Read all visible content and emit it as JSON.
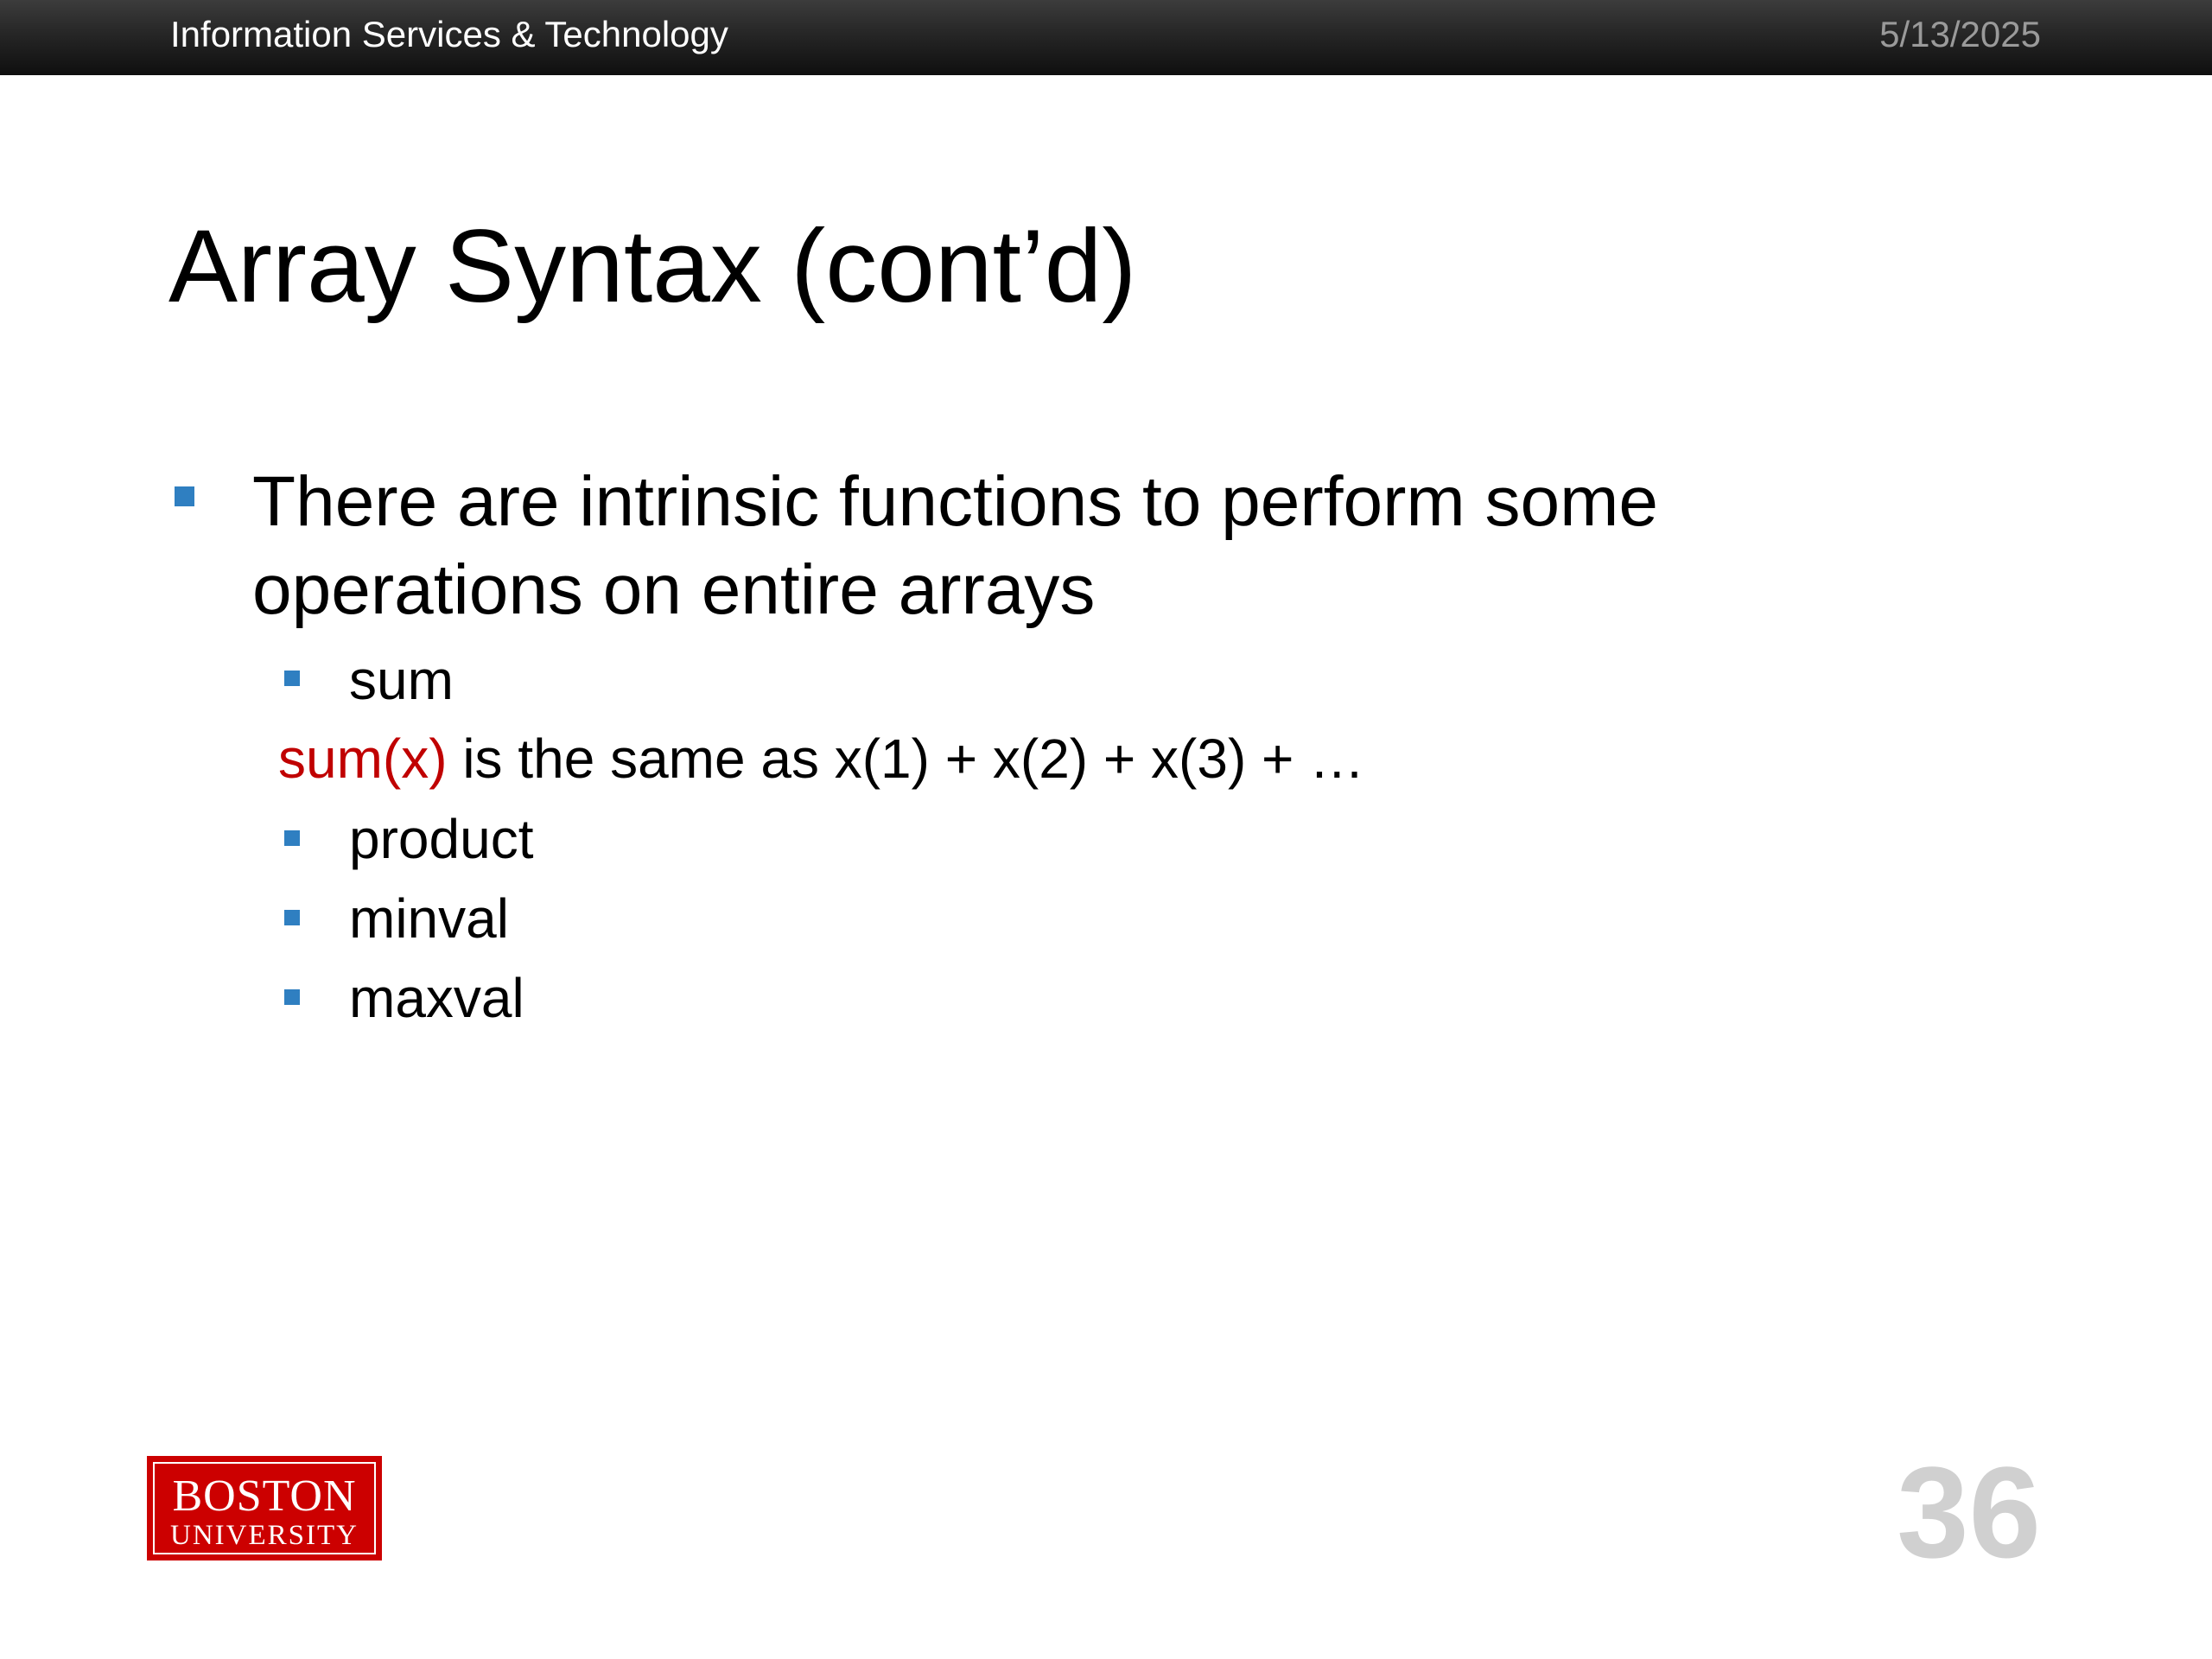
{
  "header": {
    "organization": "Information Services & Technology",
    "date": "5/13/2025"
  },
  "slide": {
    "title": "Array Syntax (cont’d)",
    "bullet": "There are intrinsic functions to perform some operations on entire arrays",
    "sub_items": [
      {
        "label": "sum"
      },
      {
        "label": "product"
      },
      {
        "label": "minval"
      },
      {
        "label": "maxval"
      }
    ],
    "equation": {
      "highlight": "sum(x)",
      "rest": " is the same as x(1) + x(2) + x(3) + …"
    },
    "page_number": "36"
  },
  "logo": {
    "line1": "BOSTON",
    "line2": "UNIVERSITY"
  },
  "colors": {
    "accent_bullet": "#2f7fc1",
    "highlight_red": "#c00000",
    "logo_red": "#cc0000",
    "header_bar": "#1a1a1a"
  }
}
